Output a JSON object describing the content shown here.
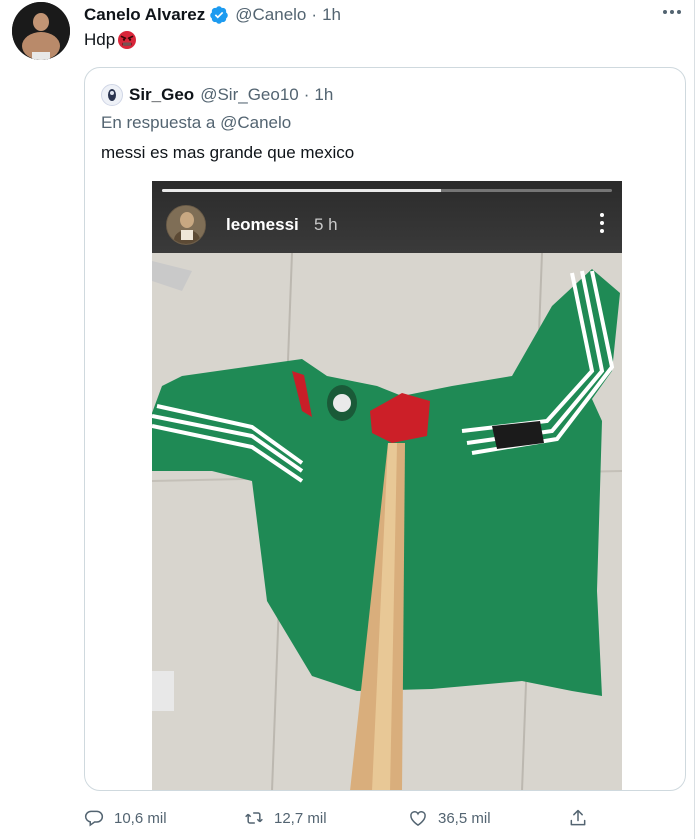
{
  "tweet": {
    "author_name": "Canelo Alvarez",
    "author_handle": "@Canelo",
    "separator": "·",
    "time": "1h",
    "text": "Hdp",
    "verified_color": "#1d9bf0"
  },
  "quote": {
    "author_name": "Sir_Geo",
    "author_handle": "@Sir_Geo10",
    "separator": "·",
    "time": "1h",
    "reply_prefix": "En respuesta a",
    "reply_mention": "@Canelo",
    "text": "messi es mas grande que mexico",
    "story": {
      "username": "leomessi",
      "time": "5 h",
      "progress": 0.62
    }
  },
  "actions": {
    "replies": "10,6 mil",
    "retweets": "12,7 mil",
    "likes": "36,5 mil"
  },
  "icons": {
    "verified": "verified-badge-icon",
    "more": "more-options-icon",
    "reply": "reply-icon",
    "retweet": "retweet-icon",
    "like": "heart-icon",
    "share": "share-icon",
    "emoji": "angry-face-emoji"
  },
  "colors": {
    "text_primary": "#0f1419",
    "text_secondary": "#536471",
    "border": "#cfd9de",
    "jersey_green": "#1f8a55",
    "floor": "#d6d3cc"
  }
}
